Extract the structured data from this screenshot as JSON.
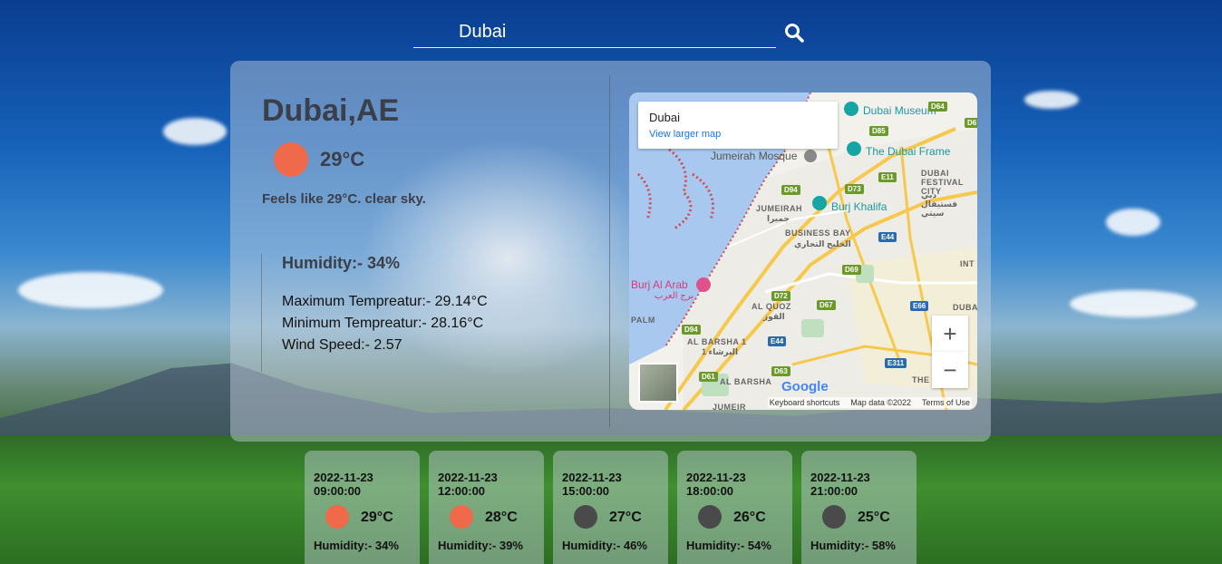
{
  "search": {
    "value": "Dubai",
    "icon": "search-icon"
  },
  "current": {
    "city": "Dubai,AE",
    "temp": "29°C",
    "icon_color": "#ef6a4a",
    "feels": "Feels like 29°C. clear sky.",
    "humidity": "Humidity:- 34%",
    "max_temp": "Maximum Tempreatur:- 29.14°C",
    "min_temp": "Minimum Tempreatur:- 28.16°C",
    "wind": "Wind Speed:- 2.57"
  },
  "map": {
    "title": "Dubai",
    "link": "View larger map",
    "zoom_in": "+",
    "zoom_out": "−",
    "google": "Google",
    "keyboard": "Keyboard shortcuts",
    "map_data": "Map data ©2022",
    "terms": "Terms of Use",
    "labels": {
      "museum": "Dubai Museum",
      "frame": "The Dubai Frame",
      "mosque": "Jumeirah Mosque",
      "khalifa": "Burj Khalifa",
      "arab": "Burj Al Arab",
      "arab_ar": "برج العرب",
      "jumeirah": "JUMEIRAH",
      "jumeirah_ar": "جميرا",
      "business_bay": "BUSINESS BAY",
      "business_bay_ar": "الخليج التجاري",
      "festival_city": "DUBAI FESTIVAL CITY",
      "festival_city_ar": "دبي فستيفال سيتي",
      "al_quoz": "AL QUOZ",
      "al_quoz_ar": "القوز",
      "al_barsha_1": "AL BARSHA 1",
      "al_barsha_1_ar": "البرشاء 1",
      "al_barsha": "AL BARSHA",
      "palm": "PALM",
      "jumeir": "JUMEIR",
      "int": "INT",
      "dubai_side": "DUBA",
      "the": "THE"
    },
    "roads": [
      "D64",
      "D6",
      "D85",
      "E11",
      "D73",
      "D94",
      "E44",
      "D69",
      "D72",
      "D67",
      "E66",
      "D94",
      "E44",
      "E311",
      "D61",
      "D63"
    ]
  },
  "forecast": [
    {
      "date": "2022-11-23",
      "time": "09:00:00",
      "temp": "29°C",
      "humidity": "Humidity:- 34%",
      "icon": "sun-icon",
      "color": "#ef6a4a"
    },
    {
      "date": "2022-11-23",
      "time": "12:00:00",
      "temp": "28°C",
      "humidity": "Humidity:- 39%",
      "icon": "sun-icon",
      "color": "#ef6a4a"
    },
    {
      "date": "2022-11-23",
      "time": "15:00:00",
      "temp": "27°C",
      "humidity": "Humidity:- 46%",
      "icon": "moon-icon",
      "color": "#4a4a4a"
    },
    {
      "date": "2022-11-23",
      "time": "18:00:00",
      "temp": "26°C",
      "humidity": "Humidity:- 54%",
      "icon": "moon-icon",
      "color": "#4a4a4a"
    },
    {
      "date": "2022-11-23",
      "time": "21:00:00",
      "temp": "25°C",
      "humidity": "Humidity:- 58%",
      "icon": "moon-icon",
      "color": "#4a4a4a"
    }
  ]
}
